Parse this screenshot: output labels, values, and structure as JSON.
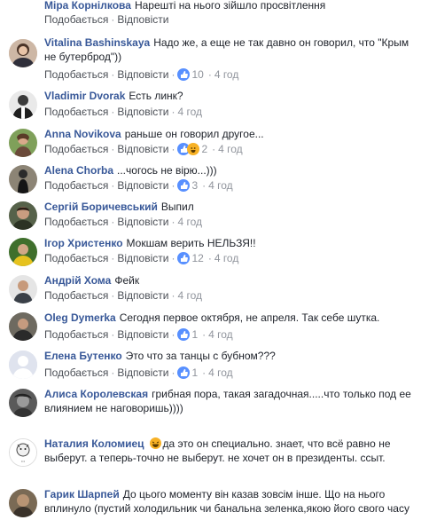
{
  "actions": {
    "like": "Подобається",
    "reply": "Відповісти",
    "dot": "·"
  },
  "comments": [
    {
      "author": "Міра Корнілкова",
      "text": "Нарешті на нього зійшло просвітлення",
      "reactions": null,
      "time": ""
    },
    {
      "author": "Vitalina Bashinskaya",
      "text": "Надо же, а еще не так давно он говорил, что \"Крым не бутерброд\"))",
      "reactions": "10",
      "time": "4 год"
    },
    {
      "author": "Vladimir Dvorak",
      "text": "Есть линк?",
      "reactions": null,
      "time": "4 год"
    },
    {
      "author": "Anna Novikova",
      "text": "раньше он говорил другое...",
      "reactions": "2",
      "time": "4 год"
    },
    {
      "author": "Alena Chorba",
      "text": "...чогось не вірю...)))",
      "reactions": "3",
      "time": "4 год"
    },
    {
      "author": "Сергій Боричевський",
      "text": "Выпил",
      "reactions": null,
      "time": "4 год"
    },
    {
      "author": "Ігор Христенко",
      "text": "Мокшам верить НЕЛЬЗЯ!!",
      "reactions": "12",
      "time": "4 год"
    },
    {
      "author": "Андрій Хома",
      "text": "Фейк",
      "reactions": null,
      "time": "4 год"
    },
    {
      "author": "Oleg Dymerka",
      "text": "Сегодня первое октября, не апреля. Так себе шутка.",
      "reactions": "1",
      "time": "4 год"
    },
    {
      "author": "Елена Бутенко",
      "text": "Это что за танцы с бубном???",
      "reactions": "1",
      "time": "4 год"
    },
    {
      "author": "Алиса Королевская",
      "text": "грибная пора, такая загадочная.....что только под ее влиянием не наговоришь))))",
      "reactions": null,
      "time": ""
    },
    {
      "author": "Наталия Коломиец",
      "text": "да это он специально. знает, что всё равно не выберут. а теперь-точно не выберут. не хочет он в президенты. ссыт.",
      "reactions": null,
      "time": ""
    },
    {
      "author": "Гарик Шарпей",
      "text": "До цього моменту він казав зовсім інше. Що на нього вплинуло (пустий холодильник чи банальна зеленка,якою його свого часу",
      "reactions": null,
      "time": ""
    }
  ],
  "colors": {
    "name": "#385898",
    "meta": "#90949c",
    "like": "#5890ff",
    "haha": "#f7b125"
  }
}
